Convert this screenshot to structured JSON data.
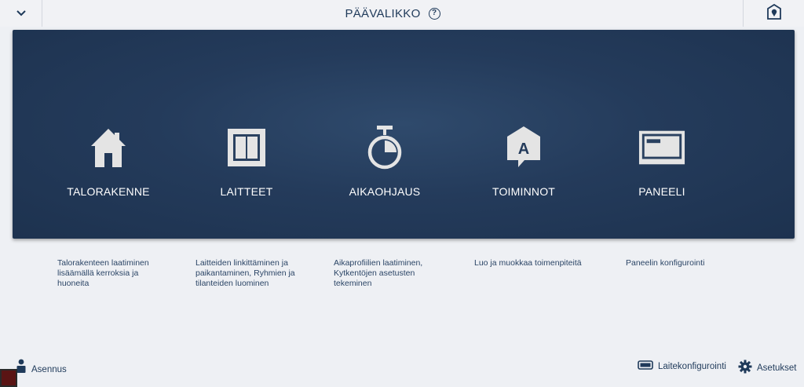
{
  "header": {
    "title": "PÄÄVALIKKO",
    "help_glyph": "?",
    "left_icon": "chevron-down-icon",
    "right_icon": "location-pin-icon"
  },
  "tiles": [
    {
      "label": "TALORAKENNE",
      "icon": "house-icon",
      "description": "Talorakenteen laatiminen lisäämällä kerroksia ja huoneita"
    },
    {
      "label": "LAITTEET",
      "icon": "device-icon",
      "description": "Laitteiden linkittäminen ja paikantaminen, Ryhmien ja tilanteiden luominen"
    },
    {
      "label": "AIKAOHJAUS",
      "icon": "stopwatch-icon",
      "description": "Aikaprofiilien laatiminen, Kytkentöjen asetusten tekeminen"
    },
    {
      "label": "TOIMINNOT",
      "icon": "action-bubble-icon",
      "icon_letter": "A",
      "description": "Luo ja muokkaa toimenpiteitä"
    },
    {
      "label": "PANEELI",
      "icon": "panel-icon",
      "description": "Paneelin konfigurointi"
    }
  ],
  "footer": {
    "user_label": "Asennus",
    "device_config_label": "Laitekonfigurointi",
    "settings_label": "Asetukset"
  },
  "colors": {
    "panel": "#243b5b",
    "background": "#eef0f4",
    "text": "#1f3a5a",
    "icon": "#e6e6e6"
  }
}
